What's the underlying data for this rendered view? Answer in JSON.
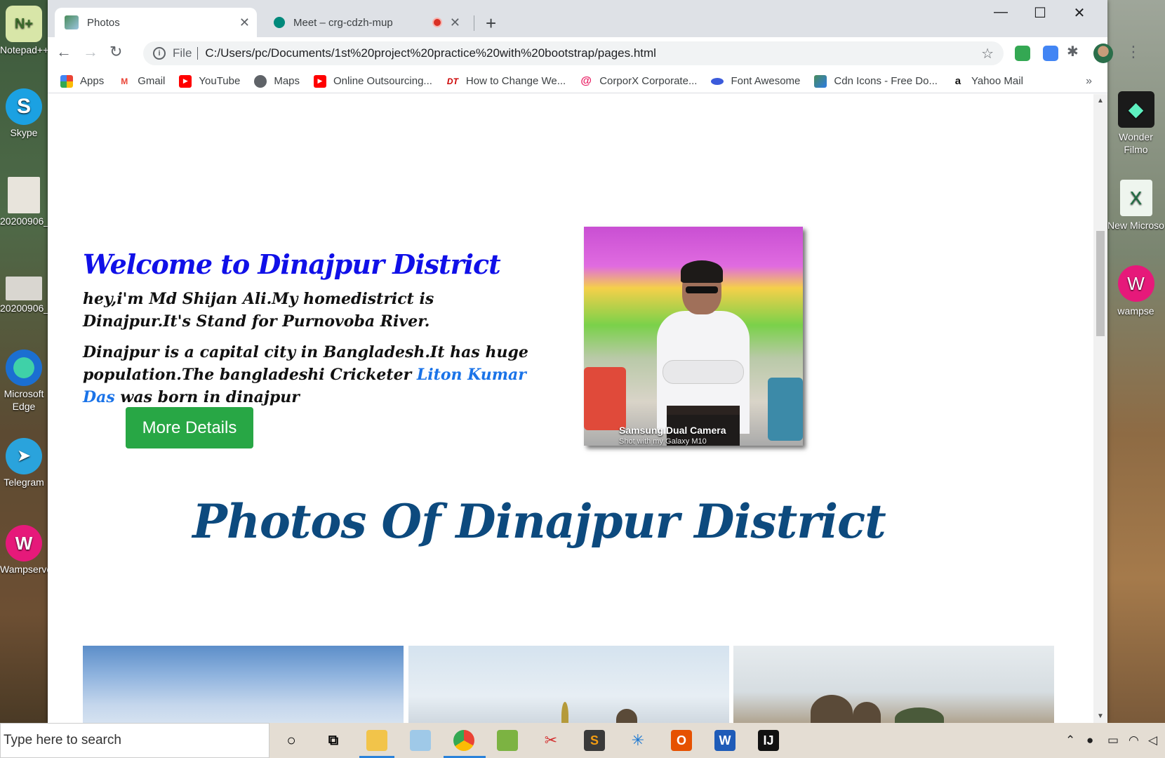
{
  "desktop": {
    "left_icons": [
      {
        "label": "Notepad++"
      },
      {
        "label": "Skype"
      },
      {
        "label": "20200906_"
      },
      {
        "label": "20200906_"
      },
      {
        "label": "Microsoft Edge"
      },
      {
        "label": "Telegram"
      },
      {
        "label": "Wampserve"
      }
    ],
    "right_icons": [
      {
        "label": "Wonder Filmo"
      },
      {
        "label": "New Microso"
      },
      {
        "label": "wampse"
      }
    ]
  },
  "browser": {
    "tabs": [
      {
        "title": "Photos",
        "active": true
      },
      {
        "title": "Meet – crg-cdzh-mup",
        "active": false
      }
    ],
    "new_tab_symbol": "+",
    "window_controls": {
      "minimize": "—",
      "maximize": "☐",
      "close": "✕"
    },
    "address": {
      "scheme": "File",
      "url": "C:/Users/pc/Documents/1st%20project%20practice%20with%20bootstrap/pages.html"
    },
    "bookmarks": [
      {
        "label": "Apps",
        "icon": "apps-grid-icon"
      },
      {
        "label": "Gmail",
        "icon": "gmail-icon"
      },
      {
        "label": "YouTube",
        "icon": "youtube-icon"
      },
      {
        "label": "Maps",
        "icon": "maps-icon"
      },
      {
        "label": "Online Outsourcing...",
        "icon": "youtube-icon"
      },
      {
        "label": "How to Change We...",
        "icon": "dt-icon"
      },
      {
        "label": "CorporX Corporate...",
        "icon": "corporx-icon"
      },
      {
        "label": "Font Awesome",
        "icon": "font-awesome-icon"
      },
      {
        "label": "Cdn Icons - Free Do...",
        "icon": "cdn-icons-icon"
      },
      {
        "label": "Yahoo Mail",
        "icon": "amazon-icon"
      }
    ],
    "bookmarks_more": "»"
  },
  "page": {
    "welcome_title": "Welcome to Dinajpur District",
    "para1": "hey,i'm Md Shijan Ali.My homedistrict is Dinajpur.It's Stand for Purnovoba River.",
    "para2_before": "Dinajpur is a capital city in Bangladesh.It has huge population.The bangladeshi Cricketer ",
    "para2_link": "Liton Kumar Das",
    "para2_after": " was born in dinajpur",
    "more_button": "More Details",
    "photo_caption_line1": "Samsung Dual Camera",
    "photo_caption_line2": "Shot with my Galaxy M10",
    "photos_title": "Photos Of Dinajpur District"
  },
  "taskbar": {
    "search_placeholder": "Type here to search"
  }
}
